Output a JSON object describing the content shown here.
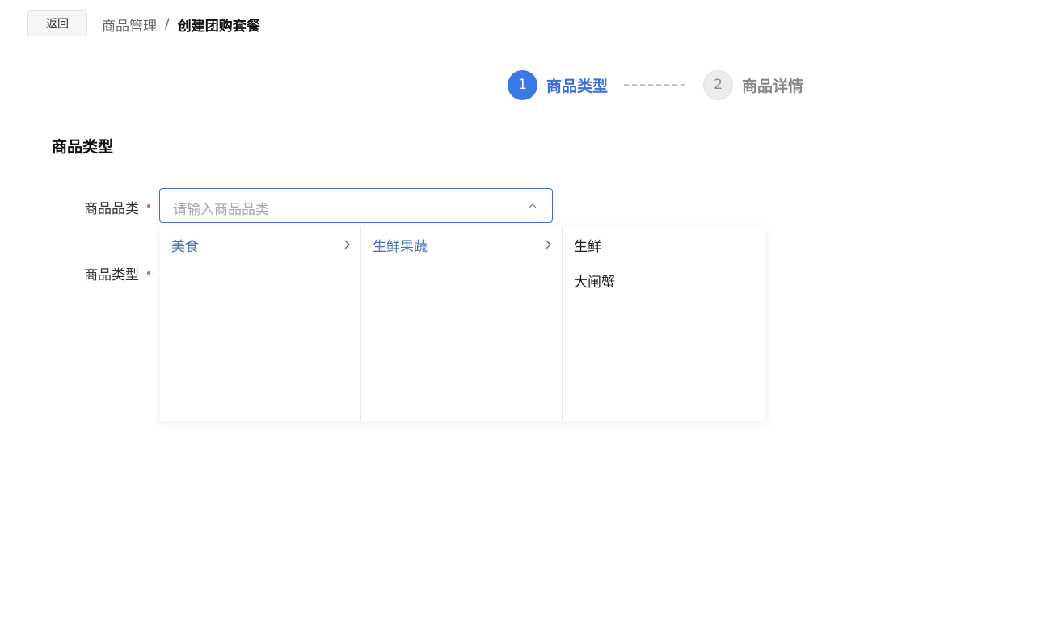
{
  "header": {
    "back_label": "返回",
    "breadcrumb": {
      "parent": "商品管理",
      "separator": "/",
      "current": "创建团购套餐"
    }
  },
  "steps": [
    {
      "number": "1",
      "label": "商品类型",
      "state": "active"
    },
    {
      "number": "2",
      "label": "商品详情",
      "state": "inactive"
    }
  ],
  "section": {
    "title": "商品类型"
  },
  "form": {
    "category_label": "商品品类",
    "category_placeholder": "请输入商品品类",
    "type_label": "商品类型"
  },
  "cascader": {
    "columns": [
      {
        "options": [
          {
            "label": "美食",
            "selected": true,
            "has_children": true
          }
        ]
      },
      {
        "options": [
          {
            "label": "生鲜果蔬",
            "selected": true,
            "has_children": true
          }
        ]
      },
      {
        "options": [
          {
            "label": "生鲜",
            "selected": false,
            "has_children": false
          },
          {
            "label": "大闸蟹",
            "selected": false,
            "has_children": false
          }
        ]
      }
    ]
  },
  "colors": {
    "accent": "#3a78e8",
    "selected_text": "#4a72b8",
    "required": "#e0605a"
  },
  "icons": [
    "chevron-up-icon",
    "chevron-right-icon"
  ]
}
